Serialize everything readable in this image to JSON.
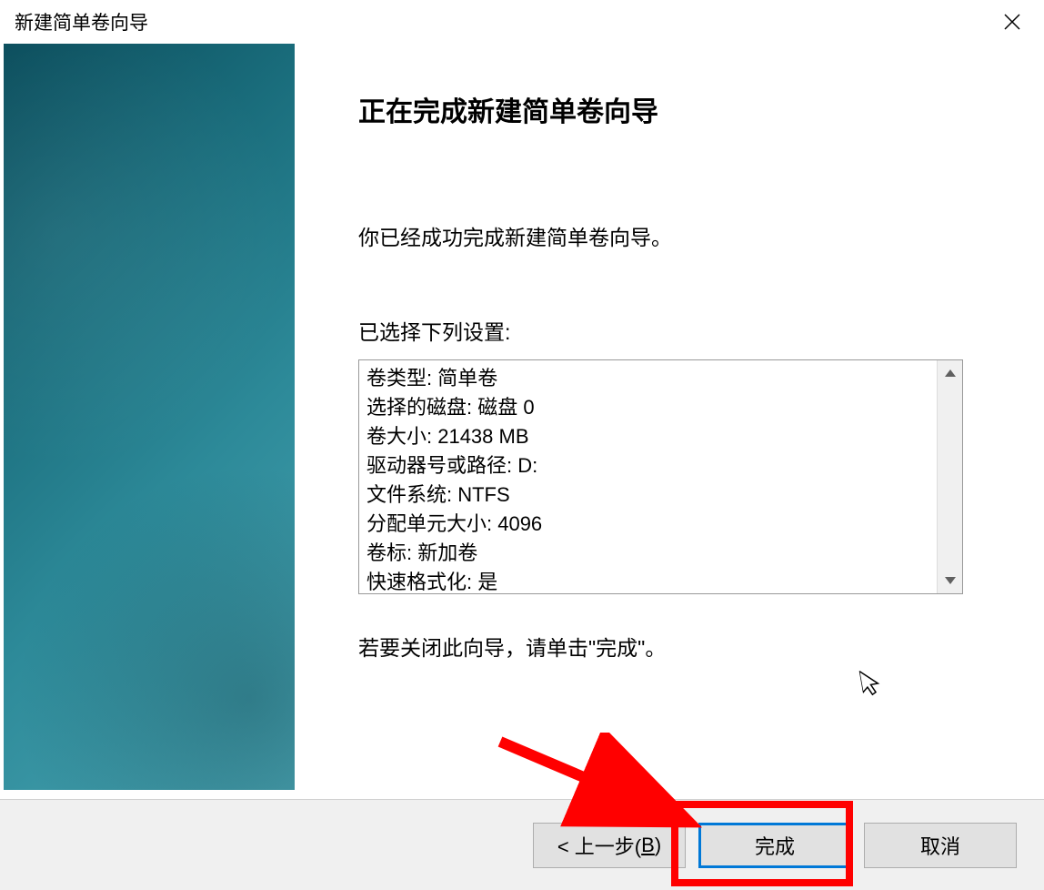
{
  "titlebar": {
    "title": "新建简单卷向导"
  },
  "main": {
    "heading": "正在完成新建简单卷向导",
    "description": "你已经成功完成新建简单卷向导。",
    "settings_label": "已选择下列设置:",
    "settings_lines": [
      "卷类型: 简单卷",
      "选择的磁盘: 磁盘 0",
      "卷大小: 21438 MB",
      "驱动器号或路径: D:",
      "文件系统: NTFS",
      "分配单元大小: 4096",
      "卷标: 新加卷",
      "快速格式化: 是"
    ],
    "closing_hint": "若要关闭此向导，请单击\"完成\"。"
  },
  "buttons": {
    "back_prefix": "< 上一步(",
    "back_key": "B",
    "back_suffix": ")",
    "finish": "完成",
    "cancel": "取消"
  }
}
